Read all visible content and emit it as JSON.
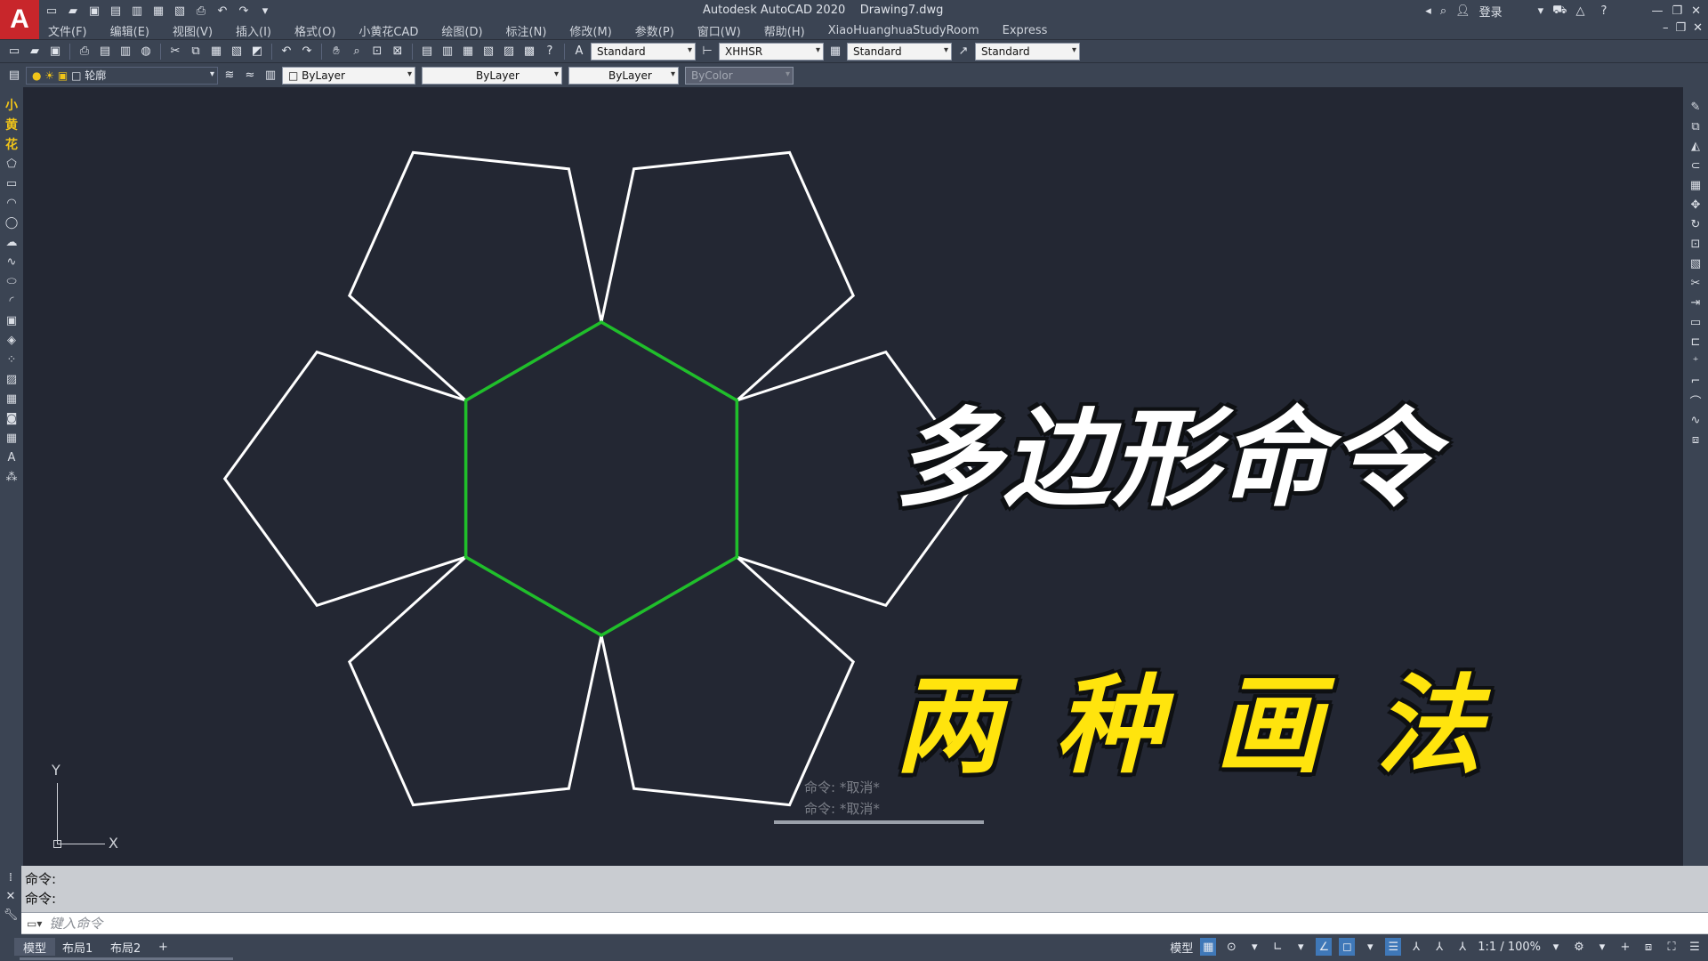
{
  "titlebar": {
    "app_title": "Autodesk AutoCAD 2020",
    "file_name": "Drawing7.dwg",
    "login": "登录"
  },
  "menu": [
    "文件(F)",
    "编辑(E)",
    "视图(V)",
    "插入(I)",
    "格式(O)",
    "小黄花CAD",
    "绘图(D)",
    "标注(N)",
    "修改(M)",
    "参数(P)",
    "窗口(W)",
    "帮助(H)",
    "XiaoHuanghuaStudyRoom",
    "Express"
  ],
  "toolbar": {
    "text_style": "Standard",
    "dim_style": "XHHSR",
    "table_style": "Standard",
    "multileader_style": "Standard",
    "layer": "轮廓",
    "color": "ByLayer",
    "linetype": "ByLayer",
    "lineweight": "ByLayer",
    "plotstyle": "ByColor"
  },
  "left_toolbar_labels": [
    "小",
    "黄",
    "花"
  ],
  "canvas": {
    "heading1": "多边形命令",
    "heading2": "两种画法",
    "overlay_cmd1": "命令: *取消*",
    "overlay_cmd2": "命令: *取消*",
    "ucs_x": "X",
    "ucs_y": "Y",
    "hexagon_color": "#1fbf2a",
    "pentagon_color": "#ffffff"
  },
  "command": {
    "history": [
      "命令:",
      "命令:"
    ],
    "placeholder": "键入命令"
  },
  "status": {
    "tabs": [
      "模型",
      "布局1",
      "布局2"
    ],
    "add_tab": "+",
    "model_label": "模型",
    "scale": "1:1 / 100%"
  }
}
